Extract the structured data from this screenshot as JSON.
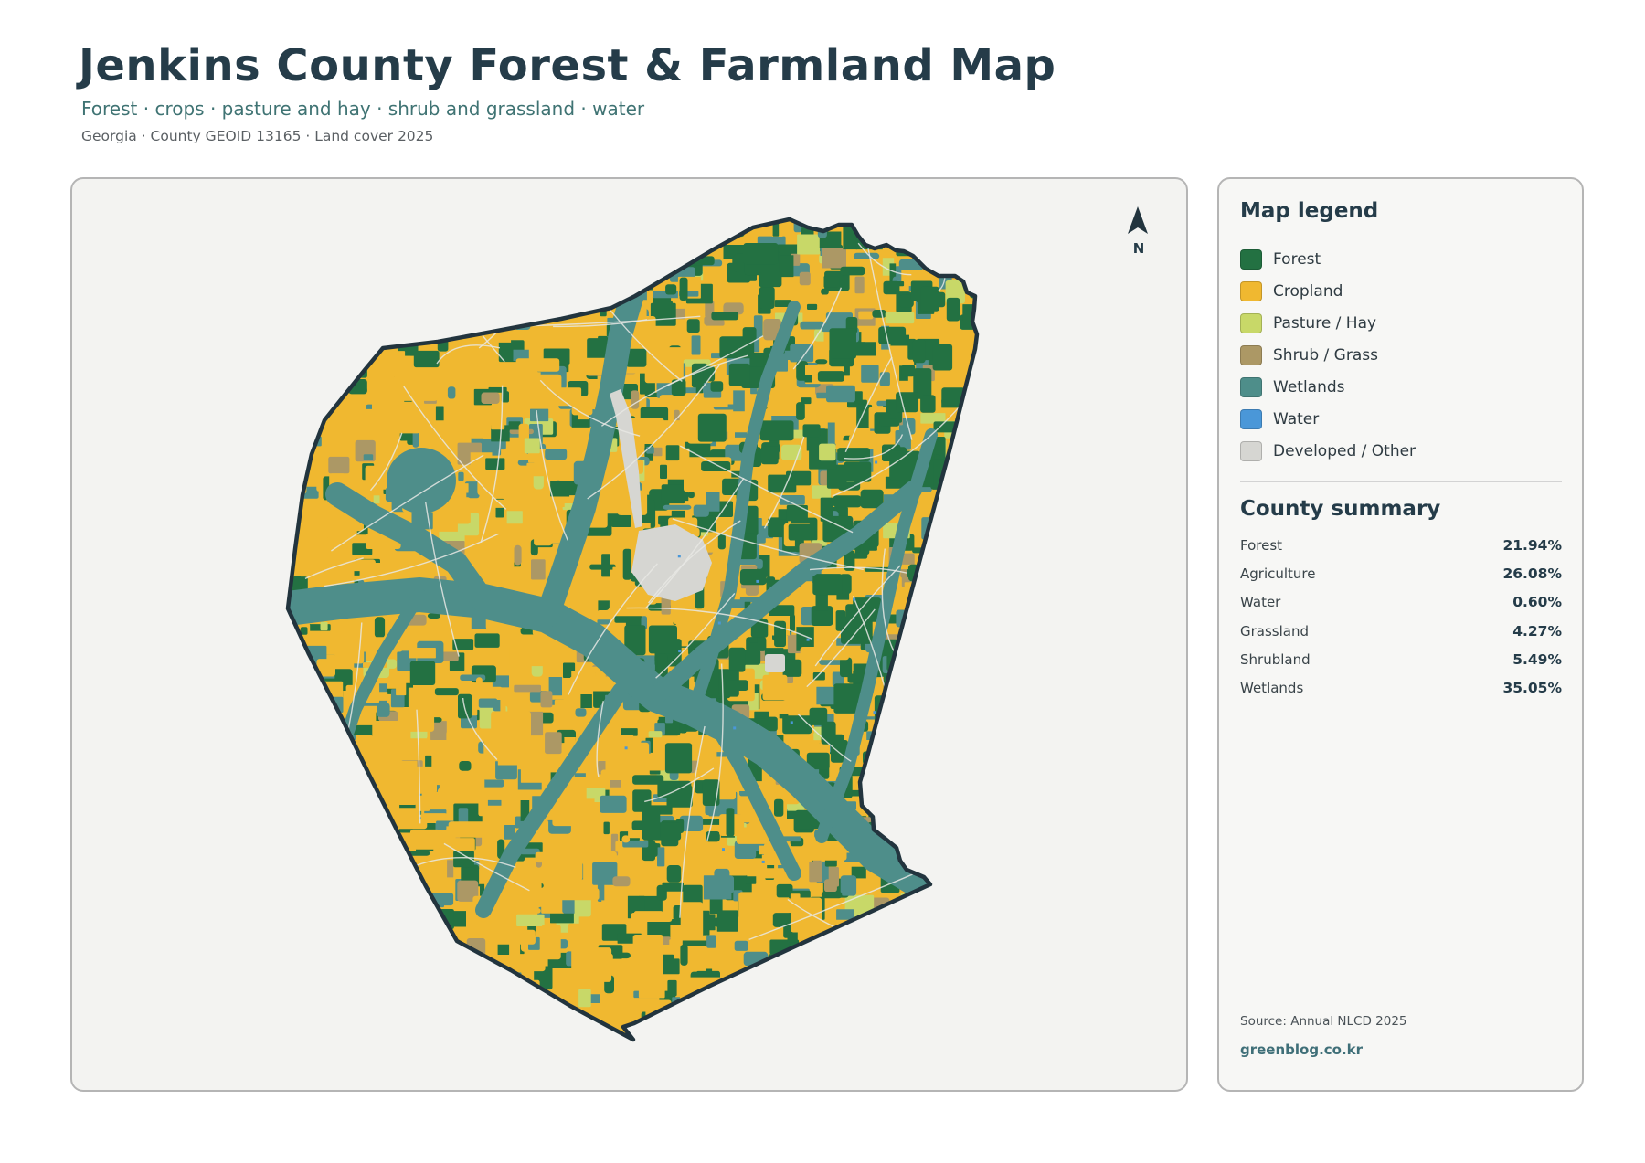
{
  "header": {
    "title": "Jenkins County Forest & Farmland Map",
    "subtitle": "Forest · crops · pasture and hay · shrub and grassland · water",
    "meta": "Georgia · County GEOID 13165 · Land cover 2025"
  },
  "map": {
    "north_label": "N",
    "colors": {
      "forest": "#237142",
      "cropland": "#f0b830",
      "pasture": "#c8d868",
      "shrub": "#ac9865",
      "wetlands": "#4e8e8a",
      "water": "#4a97d8",
      "developed": "#d6d6d2",
      "background": "#f3f3f1",
      "boundary": "#22343e"
    }
  },
  "legend": {
    "title": "Map legend",
    "items": [
      {
        "label": "Forest",
        "color": "#237142"
      },
      {
        "label": "Cropland",
        "color": "#f0b830"
      },
      {
        "label": "Pasture / Hay",
        "color": "#c8d868"
      },
      {
        "label": "Shrub / Grass",
        "color": "#ac9865"
      },
      {
        "label": "Wetlands",
        "color": "#4e8e8a"
      },
      {
        "label": "Water",
        "color": "#4a97d8"
      },
      {
        "label": "Developed / Other",
        "color": "#d6d6d2"
      }
    ]
  },
  "summary": {
    "title": "County summary",
    "rows": [
      {
        "name": "Forest",
        "value": "21.94%"
      },
      {
        "name": "Agriculture",
        "value": "26.08%"
      },
      {
        "name": "Water",
        "value": "0.60%"
      },
      {
        "name": "Grassland",
        "value": "4.27%"
      },
      {
        "name": "Shrubland",
        "value": "5.49%"
      },
      {
        "name": "Wetlands",
        "value": "35.05%"
      }
    ]
  },
  "footer": {
    "source": "Source: Annual NLCD 2025",
    "site": "greenblog.co.kr"
  }
}
